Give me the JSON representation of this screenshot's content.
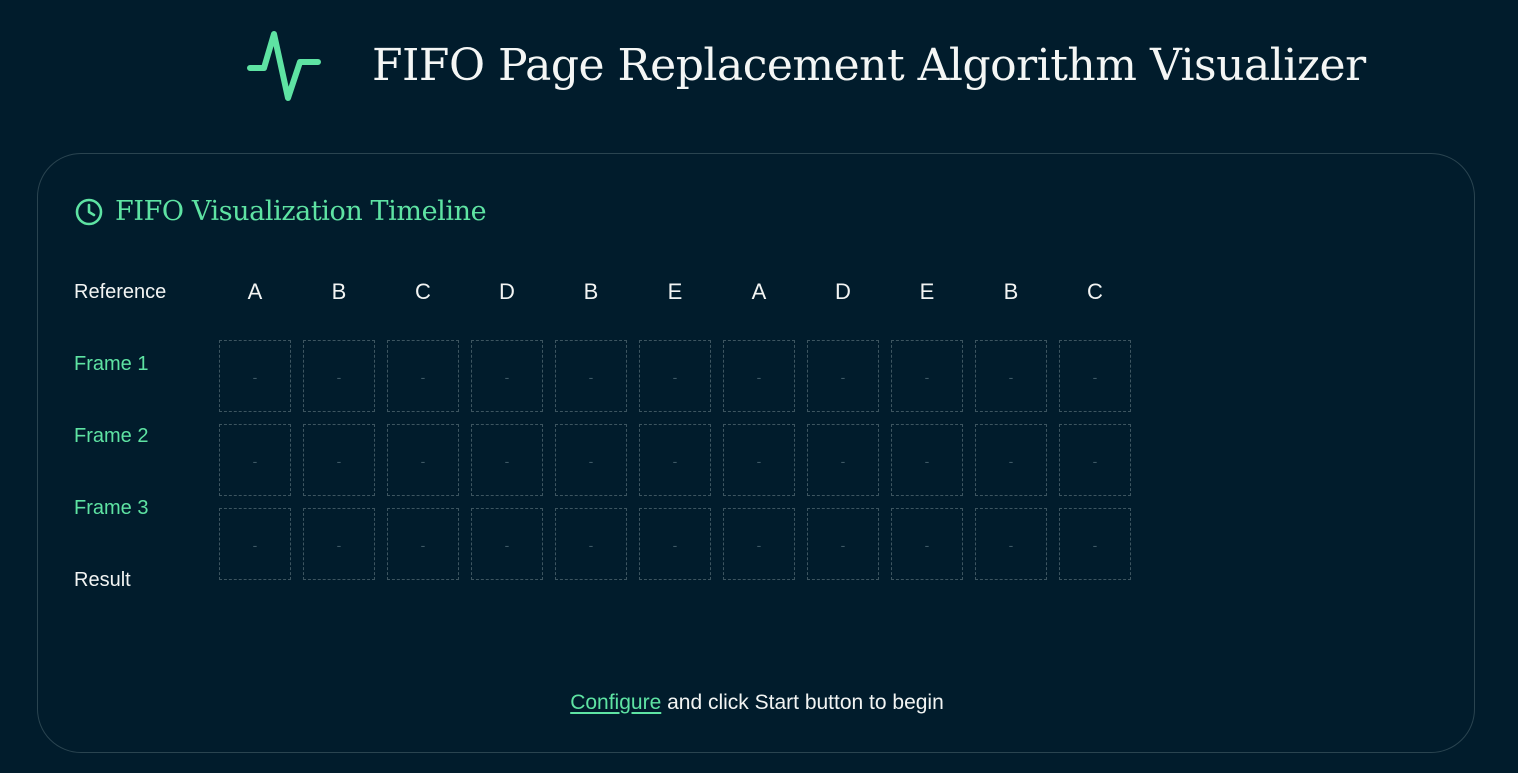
{
  "app": {
    "title": "FIFO Page Replacement Algorithm Visualizer",
    "logo_icon": "pulse-icon",
    "accent_color": "#5ee3a3",
    "background_color": "#011c2c"
  },
  "timeline": {
    "title": "FIFO Visualization Timeline",
    "icon": "clock-icon",
    "labels": {
      "reference": "Reference",
      "frame_1": "Frame 1",
      "frame_2": "Frame 2",
      "frame_3": "Frame 3",
      "result": "Result"
    },
    "references": [
      "A",
      "B",
      "C",
      "D",
      "B",
      "E",
      "A",
      "D",
      "E",
      "B",
      "C"
    ],
    "frames": [
      [
        "-",
        "-",
        "-",
        "-",
        "-",
        "-",
        "-",
        "-",
        "-",
        "-",
        "-"
      ],
      [
        "-",
        "-",
        "-",
        "-",
        "-",
        "-",
        "-",
        "-",
        "-",
        "-",
        "-"
      ],
      [
        "-",
        "-",
        "-",
        "-",
        "-",
        "-",
        "-",
        "-",
        "-",
        "-",
        "-"
      ]
    ]
  },
  "footer": {
    "configure_link": "Configure",
    "message": " and click Start button to begin"
  }
}
